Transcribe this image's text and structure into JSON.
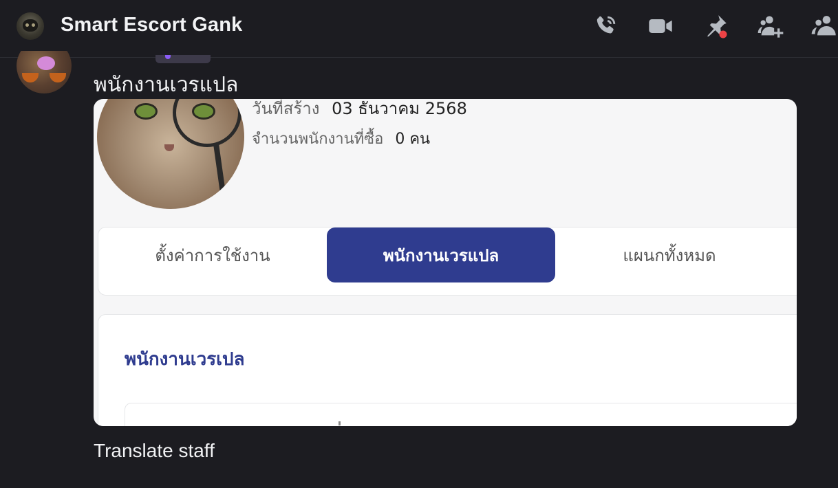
{
  "header": {
    "title": "Smart Escort Gank",
    "icons": [
      "phone-call-icon",
      "video-icon",
      "pin-icon",
      "add-member-icon",
      "members-icon"
    ],
    "pin_notification_color": "#ed4245"
  },
  "message": {
    "title": "พนักงานเวรแปล",
    "caption": "Translate staff"
  },
  "screenshot": {
    "created_label": "วันที่สร้าง",
    "created_value": "03 ธันวาคม 2568",
    "staff_count_label": "จำนวนพนักงานที่ซื้อ",
    "staff_count_value": "0 คน",
    "tabs": [
      {
        "label": "ตั้งค่าการใช้งาน",
        "active": false
      },
      {
        "label": "พนักงานเวรแปล",
        "active": true
      },
      {
        "label": "แผนกทั้งหมด",
        "active": false
      }
    ],
    "section_title": "พนักงานเวรเปล",
    "accent_color": "#2f3c8f"
  }
}
